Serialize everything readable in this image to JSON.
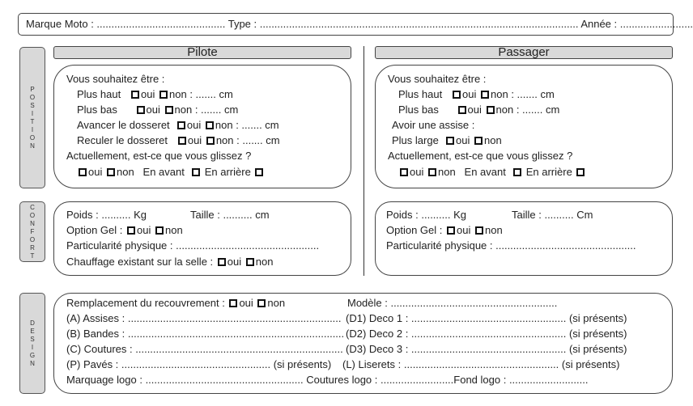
{
  "header": {
    "text": "Marque Moto : ............................................ Type : ............................................................................................................. Année : ..............................."
  },
  "tabs": {
    "position": "POSITION",
    "confort": "CONFORT",
    "design": "DESIGN"
  },
  "pilote": {
    "title": "Pilote",
    "position": {
      "intro": "Vous souhaitez être :",
      "rows": [
        "Plus haut",
        "Plus bas",
        "Avancer le dosseret",
        "Reculer le dosseret"
      ],
      "oui": "oui",
      "non": "non : ....... cm",
      "glisse": "Actuellement,  est-ce que vous glissez ?",
      "avant": "En avant",
      "arriere": "En arrière"
    },
    "confort": {
      "poids": "Poids : .......... Kg",
      "taille": "Taille : .......... cm",
      "gel": "Option Gel :",
      "particularite": "Particularité physique : .................................................",
      "chauffage": "Chauffage existant sur la selle :"
    }
  },
  "passager": {
    "title": "Passager",
    "position": {
      "intro": "Vous souhaitez être :",
      "rows": [
        "Plus haut",
        "Plus bas"
      ],
      "assise": "Avoir une assise :",
      "large": "Plus large",
      "glisse": "Actuellement,  est-ce que vous glissez ?"
    },
    "confort": {
      "poids": "Poids : .......... Kg",
      "taille": "Taille : .......... Cm",
      "gel": "Option Gel :",
      "particularite": "Particularité physique : ................................................"
    }
  },
  "common": {
    "oui": "oui",
    "non": "non",
    "non_cm": "non : ....... cm"
  },
  "design": {
    "remplacement": "Remplacement du recouvrement :",
    "modele": "Modèle : .........................................................",
    "left": [
      "(A) Assises : .........................................................................",
      "(B) Bandes : ..........................................................................",
      "(C) Coutures : .......................................................................",
      "(P) Pavés : ................................................... (si présents)"
    ],
    "right": [
      "(D1) Deco 1 : ..................................................... (si présents)",
      "(D2) Deco 2 : ..................................................... (si présents)",
      "(D3) Deco 3 : ..................................................... (si présents)",
      "(L) Liserets : ..................................................... (si présents)"
    ],
    "last": "Marquage logo : ...................................................... Coutures logo : .........................Fond logo : ..........................."
  }
}
